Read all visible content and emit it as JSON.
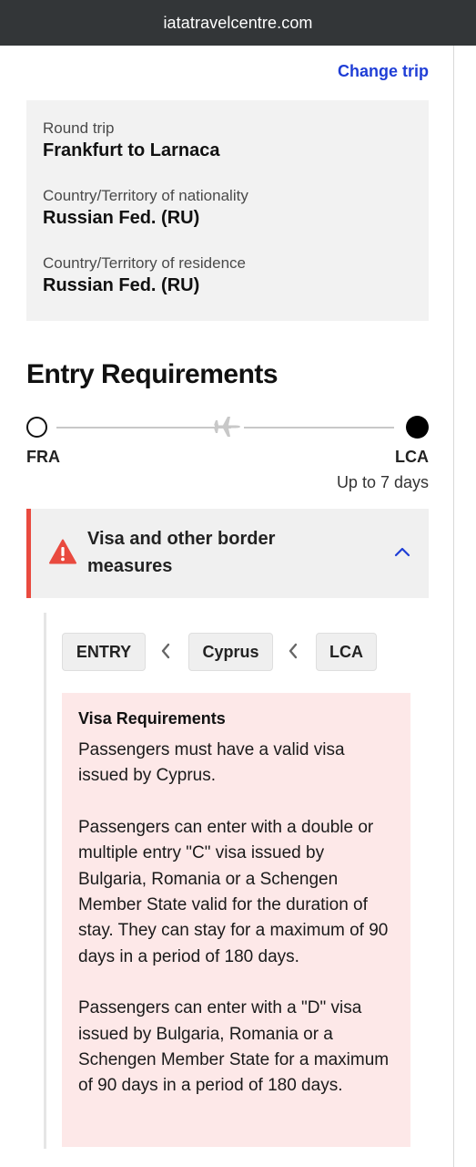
{
  "browser": {
    "url": "iatatravelcentre.com"
  },
  "trip": {
    "change_label": "Change trip",
    "type_label": "Round trip",
    "route_label": "Frankfurt to Larnaca",
    "nationality_label": "Country/Territory of nationality",
    "nationality_value": "Russian Fed. (RU)",
    "residence_label": "Country/Territory of residence",
    "residence_value": "Russian Fed. (RU)"
  },
  "entry": {
    "heading": "Entry Requirements",
    "origin_code": "FRA",
    "destination_code": "LCA",
    "duration": "Up to 7 days"
  },
  "accordion": {
    "title": "Visa and other border measures",
    "state": "expanded",
    "accent_color": "#e94a3f"
  },
  "breadcrumbs": [
    "ENTRY",
    "Cyprus",
    "LCA"
  ],
  "visa": {
    "heading": "Visa Requirements",
    "paragraphs": [
      "Passengers must have a valid visa issued by Cyprus.",
      "Passengers can enter with a double or multiple entry \"C\" visa issued by Bulgaria, Romania or a Schengen Member State valid for the duration of stay. They can stay for a maximum of 90 days in a period of 180 days.",
      "Passengers can enter with a \"D\" visa issued by Bulgaria, Romania or a Schengen Member State for a maximum of 90 days in a period of 180 days."
    ]
  },
  "colors": {
    "link": "#1f3ed6",
    "warning": "#e94a3f",
    "visa_background": "#fde8e8",
    "topbar": "#333638"
  },
  "icons": [
    "plane-icon",
    "warning-icon",
    "chevron-up-icon",
    "chevron-left-icon"
  ]
}
